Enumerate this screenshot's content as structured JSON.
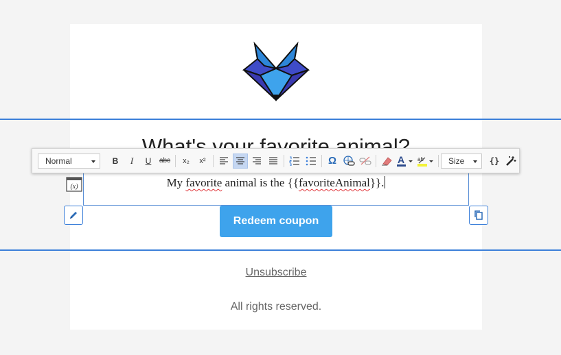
{
  "email": {
    "headline": "What's your favorite animal?",
    "text_before": "My ",
    "text_misspelled_1": "favorite",
    "text_middle": " animal is the {{",
    "text_misspelled_2": "favoriteAnimal",
    "text_after": "}}.",
    "cta_label": "Redeem coupon",
    "unsubscribe_label": "Unsubscribe",
    "footer": "All rights reserved."
  },
  "toolbar": {
    "format_select": "Normal",
    "size_select": "Size",
    "bold": "B",
    "italic": "I",
    "underline": "U",
    "strike": "abc",
    "subscript": "x₂",
    "superscript": "x²",
    "special_char": "Ω",
    "code": "{}",
    "var_icon": "(x)"
  },
  "colors": {
    "accent": "#3b7fd9",
    "button": "#3ea3ec",
    "active_tool": "#c5d7f2"
  }
}
